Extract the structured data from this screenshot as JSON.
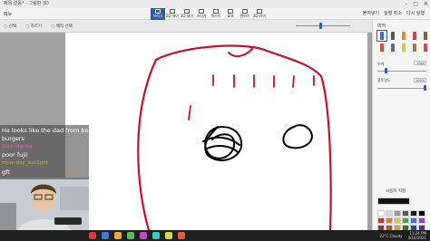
{
  "window": {
    "title": "제목 없음* - 그림판 3D"
  },
  "menu": {
    "items": [
      "메뉴",
      "캔버스",
      "3D 셰이프"
    ]
  },
  "ribbon": {
    "tools": [
      {
        "label": "브러시",
        "active": true
      },
      {
        "label": "2D 셰이프",
        "active": false
      },
      {
        "label": "3D 셰이프",
        "active": false
      },
      {
        "label": "스티커",
        "active": false
      },
      {
        "label": "텍스트",
        "active": false
      },
      {
        "label": "효과",
        "active": false
      },
      {
        "label": "캔버스",
        "active": false
      },
      {
        "label": "3D 라이브러리",
        "active": false
      }
    ],
    "right_items": [
      "붙여넣기",
      "실행 취소",
      "다시 실행"
    ]
  },
  "toolbar2": {
    "items": [
      "선택",
      "자르기",
      "매직 선택"
    ]
  },
  "panel": {
    "title": "마커",
    "brush_colors": [
      "#3a6fd8",
      "#555555",
      "#e08a3c",
      "#c24a3a",
      "#8a5a3a",
      "#d4553a",
      "#6a6a6a",
      "#d8c25a",
      "#9a7a5a",
      "#cc4a5a"
    ],
    "thickness_label": "두께",
    "thickness_value": "10px",
    "opacity_label": "불투명도",
    "opacity_value": "100%",
    "custom_label": "사용자 지정",
    "current_color": "#111111",
    "swatches": [
      "#ffffff",
      "#d8d8d8",
      "#9a9a9a",
      "#5a5a5a",
      "#1a1a1a",
      "#000000",
      "#c83232",
      "#e07a2a",
      "#e8c83a",
      "#4aa84a",
      "#3a7ad8",
      "#8a4ac8",
      "#8a3a2a",
      "#b85a2a",
      "#c8a83a",
      "#2a7a3a",
      "#2a4a9a",
      "#5a2a8a"
    ]
  },
  "chat": {
    "lines": [
      {
        "text": "He looks like the dad from bobs",
        "color": "#ffffff"
      },
      {
        "text": "burgers",
        "color": "#ffffff"
      },
      {
        "text": "Serendiptea",
        "color": "#e36a9a"
      },
      {
        "text": "poor fujii",
        "color": "#ffffff"
      },
      {
        "text": "moonday_sun1ght",
        "color": "#c8a84a"
      },
      {
        "text": "gft",
        "color": "#ffffff"
      }
    ]
  },
  "taskbar": {
    "icons": [
      "#d83a3a",
      "#3a7ad8",
      "#e8a83a",
      "#5ab85a",
      "#c84ac8",
      "#3ac8c8",
      "#d8d83a",
      "#e85a3a"
    ],
    "weather": "22°C Cloudy",
    "time": "11:24 PM",
    "date": "4/16/2021"
  }
}
